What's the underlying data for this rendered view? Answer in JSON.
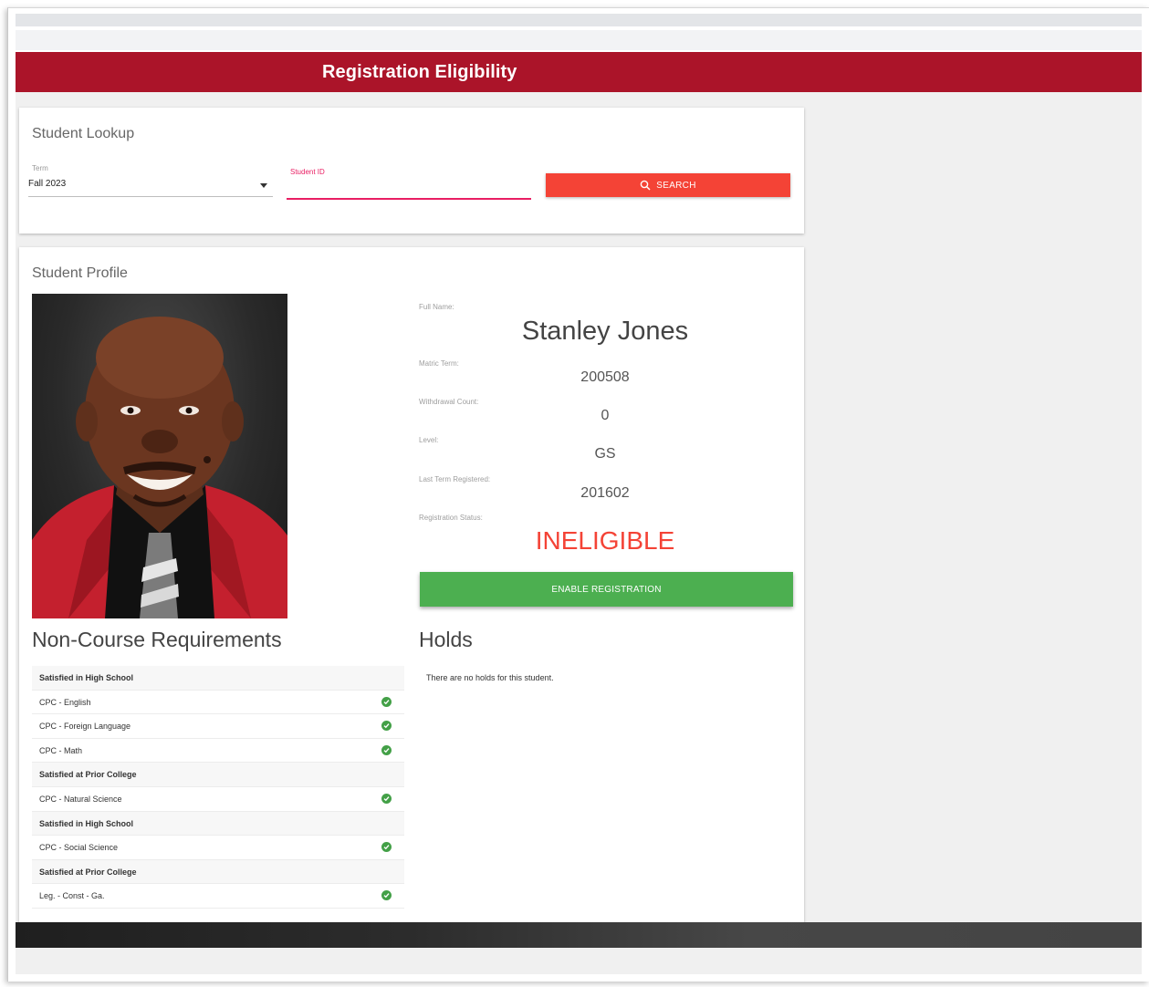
{
  "app": {
    "title": "Registration Eligibility"
  },
  "lookup": {
    "title": "Student Lookup",
    "term_label": "Term",
    "term_value": "Fall 2023",
    "student_id_label": "Student ID",
    "student_id_value": "",
    "search_label": "SEARCH"
  },
  "profile": {
    "title": "Student Profile",
    "full_name_label": "Full Name:",
    "full_name": "Stanley Jones",
    "matric_term_label": "Matric Term:",
    "matric_term": "200508",
    "withdrawal_count_label": "Withdrawal Count:",
    "withdrawal_count": "0",
    "level_label": "Level:",
    "level": "GS",
    "last_term_label": "Last Term Registered:",
    "last_term": "201602",
    "reg_status_label": "Registration Status:",
    "reg_status": "INELIGIBLE",
    "enable_label": "ENABLE REGISTRATION"
  },
  "requirements": {
    "title": "Non-Course Requirements",
    "rows": [
      {
        "text": "Satisfied in High School",
        "header": true
      },
      {
        "text": "CPC - English",
        "header": false
      },
      {
        "text": "CPC - Foreign Language",
        "header": false
      },
      {
        "text": "CPC - Math",
        "header": false
      },
      {
        "text": "Satisfied at Prior College",
        "header": true
      },
      {
        "text": "CPC - Natural Science",
        "header": false
      },
      {
        "text": "Satisfied in High School",
        "header": true
      },
      {
        "text": "CPC - Social Science",
        "header": false
      },
      {
        "text": "Satisfied at Prior College",
        "header": true
      },
      {
        "text": "Leg. - Const - Ga.",
        "header": false
      }
    ]
  },
  "holds": {
    "title": "Holds",
    "message": "There are no holds for this student."
  },
  "colors": {
    "brand": "#ab1429",
    "search": "#f44336",
    "enable": "#4caf50",
    "ineligible": "#f44336",
    "check": "#43a047"
  }
}
